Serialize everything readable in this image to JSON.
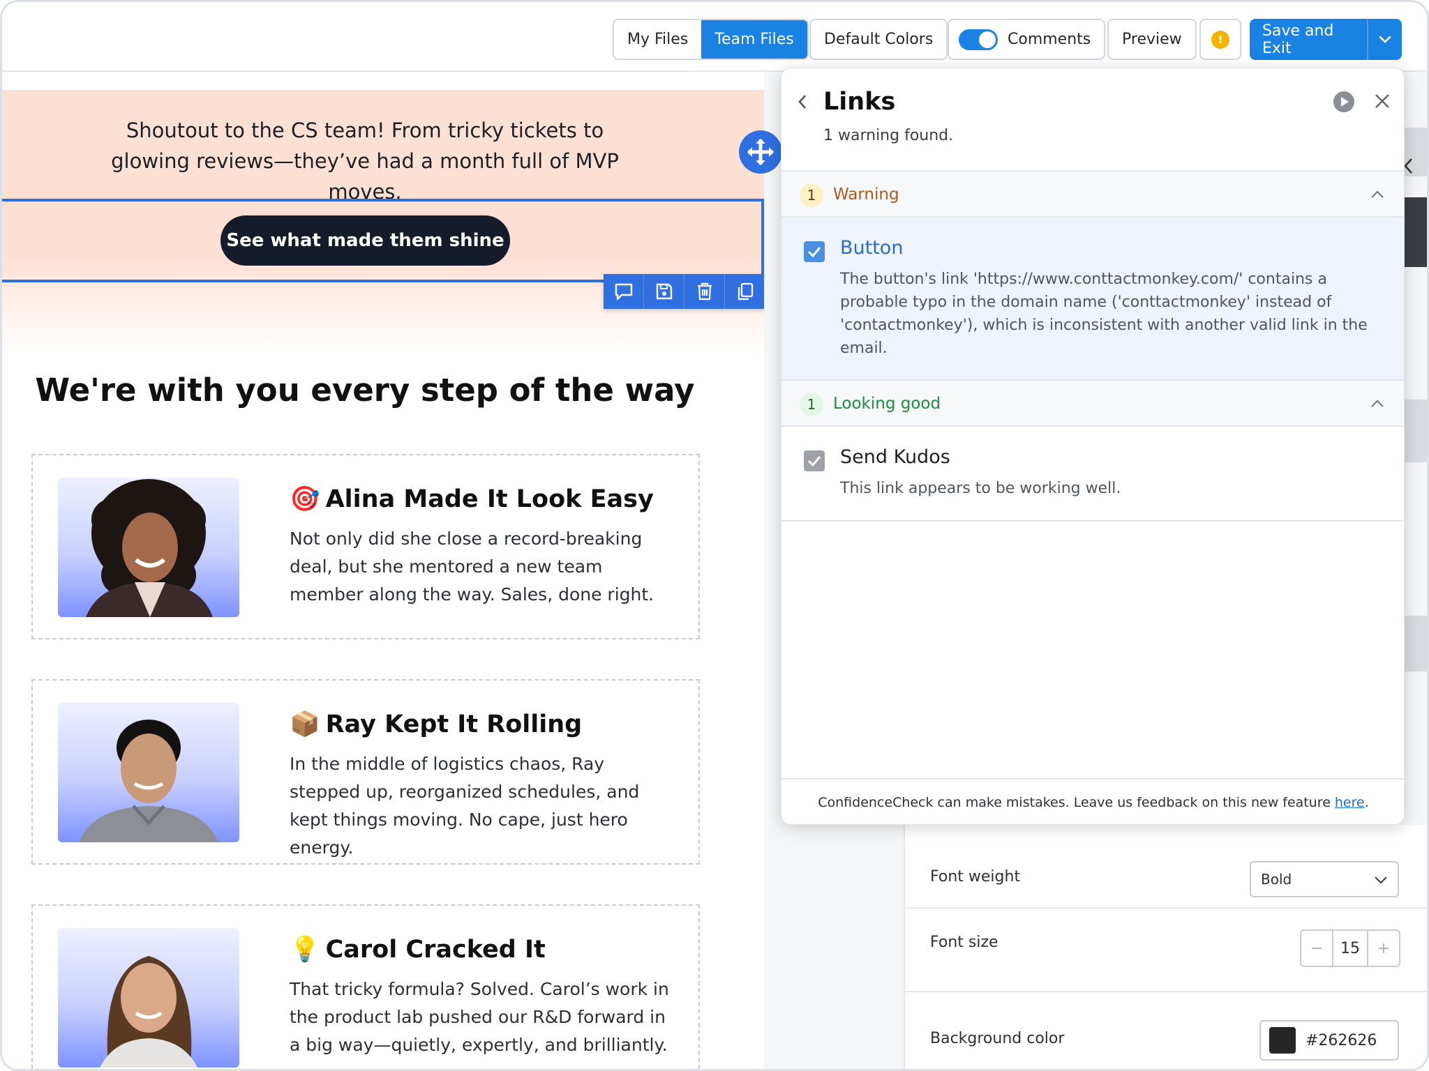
{
  "topbar": {
    "my_files": "My Files",
    "team_files": "Team Files",
    "default_colors": "Default Colors",
    "comments": "Comments",
    "preview": "Preview",
    "warning_indicator": "!",
    "save_and_exit": "Save and Exit"
  },
  "email": {
    "shoutout": "Shoutout to the CS team! From tricky tickets to glowing reviews—they’ve had a month full of MVP moves.",
    "cta": "See what made them shine",
    "section_title": "We're with you every step of the way",
    "cards": [
      {
        "emoji": "🎯",
        "title": "Alina Made It Look Easy",
        "body": "Not only did she close a record-breaking deal, but she mentored a new team member along the way. Sales, done right."
      },
      {
        "emoji": "📦",
        "title": "Ray Kept It Rolling",
        "body": "In the middle of logistics chaos, Ray stepped up, reorganized schedules, and kept things moving. No cape, just hero energy."
      },
      {
        "emoji": "💡",
        "title": "Carol Cracked It",
        "body": "That tricky formula? Solved. Carol’s work in the product lab pushed our R&D forward in a big way—quietly, expertly, and brilliantly."
      }
    ]
  },
  "settings": {
    "font_weight_label": "Font weight",
    "font_weight_value": "Bold",
    "font_size_label": "Font size",
    "font_size_value": "15",
    "font_size_minus": "−",
    "font_size_plus": "+",
    "bg_color_label": "Background color",
    "bg_color_value": "#262626"
  },
  "links_panel": {
    "title": "Links",
    "subtitle": "1 warning found.",
    "warning_section": {
      "count": "1",
      "label": "Warning",
      "item_title": "Button",
      "item_body": "The button's link 'https://www.conttactmonkey.com/' contains a probable typo in the domain name ('conttactmonkey' instead of 'contactmonkey'), which is inconsistent with another valid link in the email."
    },
    "good_section": {
      "count": "1",
      "label": "Looking good",
      "item_title": "Send Kudos",
      "item_body": "This link appears to be working well."
    },
    "footer_text": "ConfidenceCheck can make mistakes. Leave us feedback on this new feature",
    "footer_link": "here",
    "footer_end": "."
  },
  "colors": {
    "accent": "#1a82e2",
    "selection": "#2f6fe0",
    "banner": "#fde0d4",
    "cta_bg": "#161b2b",
    "warning_text": "#b0591a",
    "warning_badge": "#fdf0c2",
    "good_text": "#1e8a3c",
    "good_badge": "#e3f6e8"
  }
}
